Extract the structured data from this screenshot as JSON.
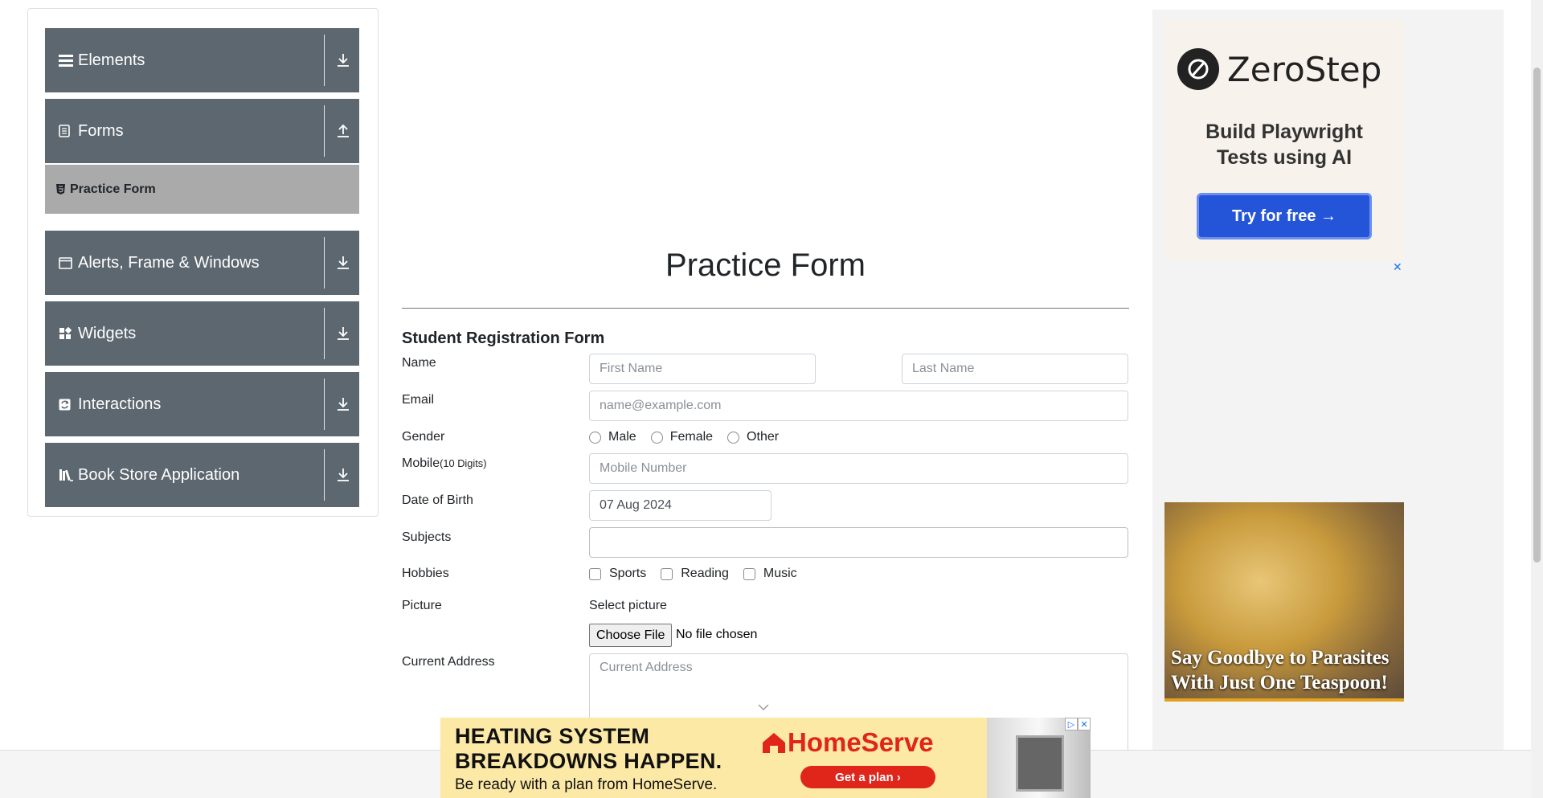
{
  "sidebar": {
    "groups": [
      {
        "label": "Elements",
        "icon": "hamburger-icon",
        "arrow": "download-arrow-icon"
      },
      {
        "label": "Forms",
        "icon": "document-icon",
        "arrow": "upload-arrow-icon"
      },
      {
        "label": "Alerts, Frame & Windows",
        "icon": "window-icon",
        "arrow": "download-arrow-icon"
      },
      {
        "label": "Widgets",
        "icon": "widgets-icon",
        "arrow": "download-arrow-icon"
      },
      {
        "label": "Interactions",
        "icon": "interactions-icon",
        "arrow": "download-arrow-icon"
      },
      {
        "label": "Book Store Application",
        "icon": "books-icon",
        "arrow": "download-arrow-icon"
      }
    ],
    "active_item": {
      "label": "Practice Form",
      "icon": "html5-icon"
    }
  },
  "main": {
    "title": "Practice Form",
    "form_title": "Student Registration Form",
    "labels": {
      "name": "Name",
      "email": "Email",
      "gender": "Gender",
      "mobile": "Mobile",
      "mobile_hint": "(10 Digits)",
      "dob": "Date of Birth",
      "subjects": "Subjects",
      "hobbies": "Hobbies",
      "picture": "Picture",
      "address": "Current Address"
    },
    "placeholders": {
      "first_name": "First Name",
      "last_name": "Last Name",
      "email": "name@example.com",
      "mobile": "Mobile Number",
      "address": "Current Address"
    },
    "dob_value": "07 Aug 2024",
    "gender_options": [
      "Male",
      "Female",
      "Other"
    ],
    "hobby_options": [
      "Sports",
      "Reading",
      "Music"
    ],
    "picture": {
      "select_label": "Select picture",
      "button": "Choose File",
      "status": "No file chosen"
    }
  },
  "ads": {
    "zerostep": {
      "brand": "ZeroStep",
      "tagline_line1": "Build Playwright",
      "tagline_line2": "Tests using AI",
      "cta": "Try for free →"
    },
    "parasites": {
      "line1": "Say Goodbye to Parasites",
      "line2": "With Just One Teaspoon!"
    },
    "homeserve": {
      "headline_line1": "HEATING SYSTEM",
      "headline_line2": "BREAKDOWNS HAPPEN.",
      "sub": "Be ready with a plan from HomeServe.",
      "brand": "HomeServe",
      "cta": "Get a plan ›"
    },
    "close_glyph": "✕"
  }
}
